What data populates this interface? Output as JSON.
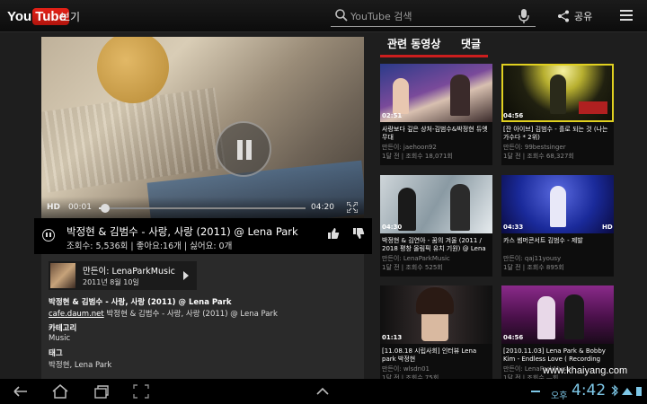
{
  "header": {
    "logo_you": "You",
    "logo_tube": "Tube",
    "view_label": "보기",
    "search_placeholder": "YouTube 검색",
    "share_label": "공유"
  },
  "player": {
    "hd_badge": "HD",
    "time_current": "00:01",
    "time_total": "04:20",
    "progress": 0.03
  },
  "video": {
    "title": "박정현 & 김범수 - 사랑, 사랑 (2011) @ Lena Park",
    "stats": "조회수: 5,536회 | 좋아요:16개 | 싫어요: 0개"
  },
  "details": {
    "uploader_name": "만든이: LenaParkMusic",
    "upload_date": "2011년 8월 10일",
    "description_title": "박정현 & 김범수 - 사랑, 사랑 (2011) @ Lena Park",
    "description_link": "cafe.daum.net",
    "description_rest": " 박정현 & 김범수 - 사랑, 사랑 (2011) @ Lena Park",
    "category_heading": "카테고리",
    "category_value": "Music",
    "tags_heading": "태그",
    "tags_value": "박정현, Lena Park"
  },
  "related": {
    "tab_related": "관련 동영상",
    "tab_comments": "댓글",
    "videos": [
      {
        "duration": "02:51",
        "hd": "",
        "title": "사랑보다 깊은 상처-김범수&박정현 듀엣 무대",
        "by": "만든이: jaehoon92",
        "meta": "1달 전 | 조회수 18,071회"
      },
      {
        "duration": "04:56",
        "hd": "",
        "title": "[잔 아이브] 김범수 - 흘로 되는 것 (나는 가수다 * 2위)",
        "by": "만든이: 99bestsinger",
        "meta": "1달 전 | 조회수 68,327회"
      },
      {
        "duration": "04:30",
        "hd": "",
        "title": "박정현 & 김연아 - 꿈의 겨울 (2011 / 2018 평창 올림픽 유치 기원) @ Lena",
        "by": "만든이: LenaParkMusic",
        "meta": "1달 전 | 조회수 525회"
      },
      {
        "duration": "04:33",
        "hd": "HD",
        "title": "카스 썸머콘서트 김범수 - 제발",
        "by": "만든이: qaj11yousy",
        "meta": "1달 전 | 조회수 895회"
      },
      {
        "duration": "01:13",
        "hd": "",
        "title": "[11.08.18 시립사회] 인터뷰 Lena park 박정현",
        "by": "만든이: wlsdn01",
        "meta": "1달 전 | 조회수 75회"
      },
      {
        "duration": "04:56",
        "hd": "",
        "title": "[2010.11.03] Lena Park & Bobby Kim - Endless Love ( Recording Shot /",
        "by": "만든이: LenaParkMusic",
        "meta": "1달 전 | 조회수 —회"
      }
    ]
  },
  "system": {
    "ampm": "오후",
    "time": "4:42",
    "watermark": "www.khaiyang.com"
  },
  "colors": {
    "accent": "#cc1e1e",
    "clock": "#7ec8e8"
  }
}
